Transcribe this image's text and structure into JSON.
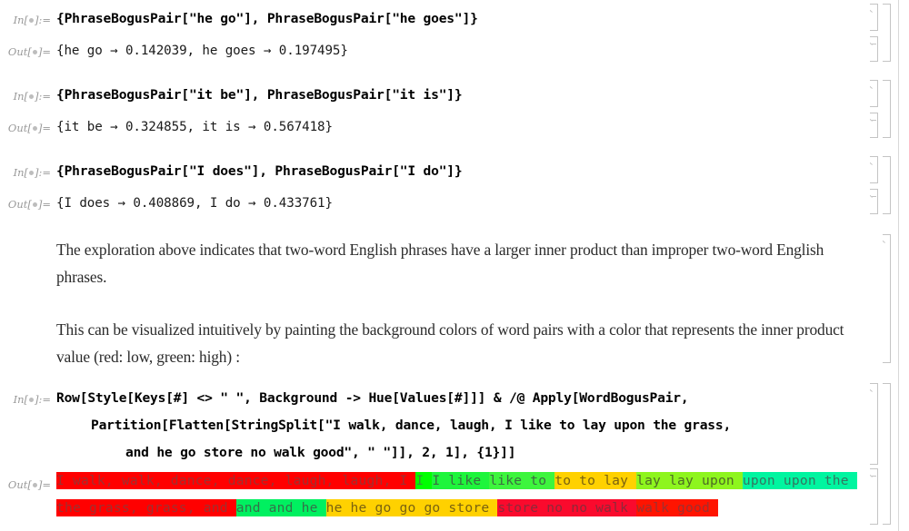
{
  "app": {
    "kind": "mathematica-notebook"
  },
  "labels": {
    "in": "In[",
    "in_suffix": "]:=",
    "out": "Out[",
    "out_suffix": "]="
  },
  "cells": [
    {
      "type": "input",
      "label": "in",
      "lines": [
        "{PhraseBogusPair[\"he go\"], PhraseBogusPair[\"he goes\"]}"
      ]
    },
    {
      "type": "output",
      "label": "out",
      "lines": [
        "{he go → 0.142039, he goes → 0.197495}"
      ]
    },
    {
      "type": "input",
      "label": "in",
      "lines": [
        "{PhraseBogusPair[\"it be\"], PhraseBogusPair[\"it is\"]}"
      ]
    },
    {
      "type": "output",
      "label": "out",
      "lines": [
        "{it be → 0.324855, it is → 0.567418}"
      ]
    },
    {
      "type": "input",
      "label": "in",
      "lines": [
        "{PhraseBogusPair[\"I does\"], PhraseBogusPair[\"I do\"]}"
      ]
    },
    {
      "type": "output",
      "label": "out",
      "lines": [
        "{I does → 0.408869, I do → 0.433761}"
      ]
    }
  ],
  "text_cells": [
    "The exploration above indicates that two-word English phrases have a larger inner product than improper two-word English phrases.",
    "This can be visualized intuitively by painting the background colors of word pairs with a color that represents the inner product value (red: low, green: high) :"
  ],
  "code_cell": {
    "label": "in",
    "lines": [
      "Row[Style[Keys[#] <> \" \", Background -> Hue[Values[#]]] & /@ Apply[WordBogusPair,",
      "Partition[Flatten[StringSplit[\"I walk, dance, laugh, I like to lay upon the grass,",
      "and he go store no walk good\", \" \"]], 2, 1], {1}]]"
    ],
    "indents": [
      0,
      38,
      76
    ]
  },
  "result_row": {
    "label": "out",
    "line1": [
      {
        "text": "I walk, ",
        "bg": "#FF0000",
        "fg": "#9E3030"
      },
      {
        "text": "walk, dance, ",
        "bg": "#FF0000",
        "fg": "#9E3030"
      },
      {
        "text": "dance, laugh, ",
        "bg": "#FF0000",
        "fg": "#9E3030"
      },
      {
        "text": "laugh, I ",
        "bg": "#FF0000",
        "fg": "#9E3030"
      },
      {
        "text": "I ",
        "bg": "#00FF00",
        "fg": "#3F8F3F"
      },
      {
        "text": "I like ",
        "bg": "#1EF53C",
        "fg": "#3C6B42"
      },
      {
        "text": "like to ",
        "bg": "#3DF53D",
        "fg": "#3C6B42"
      },
      {
        "text": "to ",
        "bg": "#FFD100",
        "fg": "#7A6210"
      },
      {
        "text": "to lay ",
        "bg": "#FFD100",
        "fg": "#7A6210"
      },
      {
        "text": "lay ",
        "bg": "#8EF51E",
        "fg": "#4D6B25"
      },
      {
        "text": "lay upon ",
        "bg": "#8EF51E",
        "fg": "#4D6B25"
      },
      {
        "text": "upon ",
        "bg": "#00F5A0",
        "fg": "#357561"
      },
      {
        "text": "upon the ",
        "bg": "#00F5A0",
        "fg": "#357561"
      }
    ],
    "line2": [
      {
        "text": "the grass, ",
        "bg": "#FF0000",
        "fg": "#9E3030"
      },
      {
        "text": "grass, and ",
        "bg": "#FF0000",
        "fg": "#9E3030"
      },
      {
        "text": "and ",
        "bg": "#00F060",
        "fg": "#35704A"
      },
      {
        "text": "and he ",
        "bg": "#00F060",
        "fg": "#35704A"
      },
      {
        "text": "he ",
        "bg": "#FFD100",
        "fg": "#7A6210"
      },
      {
        "text": "he go ",
        "bg": "#FFD100",
        "fg": "#7A6210"
      },
      {
        "text": "go ",
        "bg": "#FFD100",
        "fg": "#7A6210"
      },
      {
        "text": "go store ",
        "bg": "#FFD100",
        "fg": "#7A6210"
      },
      {
        "text": "store no ",
        "bg": "#FA0A2D",
        "fg": "#8C2A3A"
      },
      {
        "text": "no walk ",
        "bg": "#FA0A2D",
        "fg": "#8C2A3A"
      },
      {
        "text": "walk good ",
        "bg": "#FF1400",
        "fg": "#9E3030"
      }
    ]
  },
  "colors": {
    "label_gray": "#999999",
    "bracket_gray": "#c4c4c4",
    "code_black": "#000000",
    "text_gray": "#2b2b2b",
    "low_value": "#FF0000",
    "high_value": "#00FF00"
  }
}
